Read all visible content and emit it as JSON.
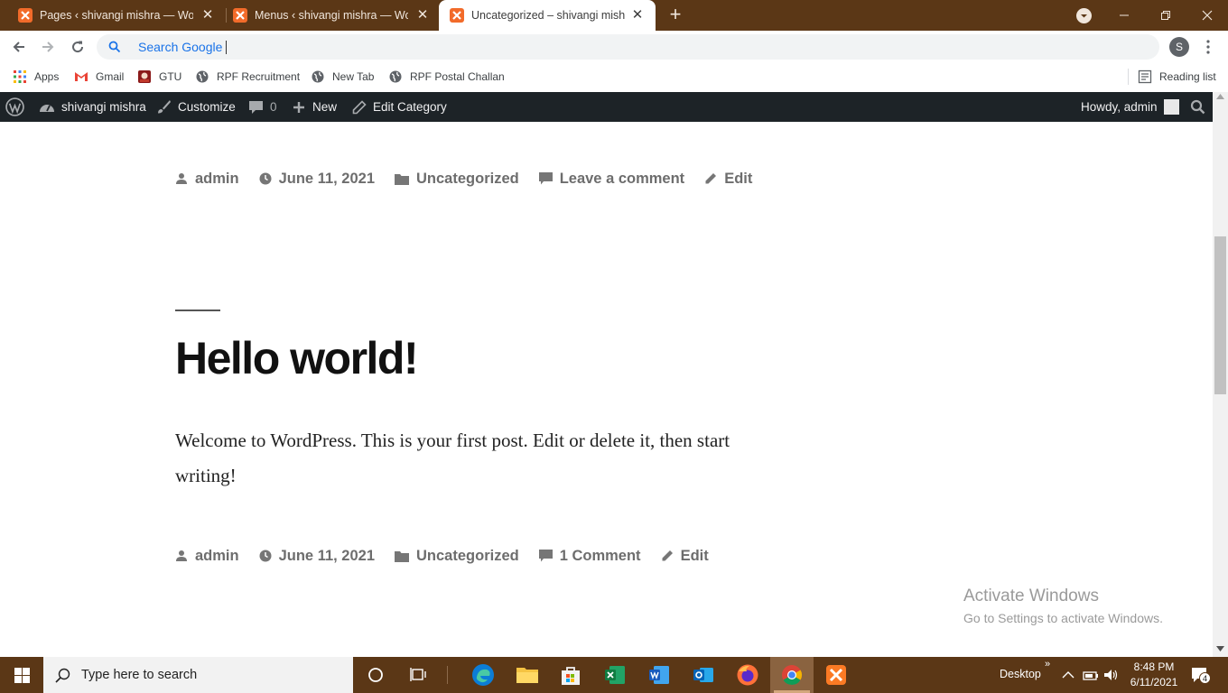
{
  "browser": {
    "tabs": [
      {
        "title": "Pages ‹ shivangi mishra — WordPress",
        "active": false
      },
      {
        "title": "Menus ‹ shivangi mishra — WordPress",
        "active": false
      },
      {
        "title": "Uncategorized – shivangi mishra",
        "active": true
      }
    ],
    "new_tab": "+",
    "close_glyph": "✕",
    "omnibox_placeholder": "Search Google",
    "profile_initial": "S"
  },
  "bookmarks": {
    "items": [
      {
        "label": "Apps",
        "icon": "apps-grid-icon"
      },
      {
        "label": "Gmail",
        "icon": "gmail-icon"
      },
      {
        "label": "GTU",
        "icon": "gtu-icon"
      },
      {
        "label": "RPF Recruitment",
        "icon": "globe-icon"
      },
      {
        "label": "New Tab",
        "icon": "globe-icon"
      },
      {
        "label": "RPF Postal Challan",
        "icon": "globe-icon"
      }
    ],
    "reading_list": "Reading list"
  },
  "adminbar": {
    "site_name": "shivangi mishra",
    "customize": "Customize",
    "comments_count": "0",
    "new": "New",
    "edit_category": "Edit Category",
    "howdy": "Howdy, admin"
  },
  "post_prev_meta": {
    "author": "admin",
    "date": "June 11, 2021",
    "category": "Uncategorized",
    "comments": "Leave a comment",
    "edit": "Edit"
  },
  "post": {
    "title": "Hello world!",
    "body": "Welcome to WordPress. This is your first post. Edit or delete it, then start writing!",
    "meta": {
      "author": "admin",
      "date": "June 11, 2021",
      "category": "Uncategorized",
      "comments": "1 Comment",
      "edit": "Edit"
    }
  },
  "watermark": {
    "line1": "Activate Windows",
    "line2": "Go to Settings to activate Windows."
  },
  "taskbar": {
    "search_placeholder": "Type here to search",
    "desktop_label": "Desktop",
    "time": "8:48 PM",
    "date": "6/11/2021",
    "notification_count": "4"
  },
  "colors": {
    "chrome_frame": "#5b3716",
    "wp_adminbar": "#1d2327",
    "meta_text": "#6d6d6d",
    "xampp_orange": "#f26b2a"
  }
}
